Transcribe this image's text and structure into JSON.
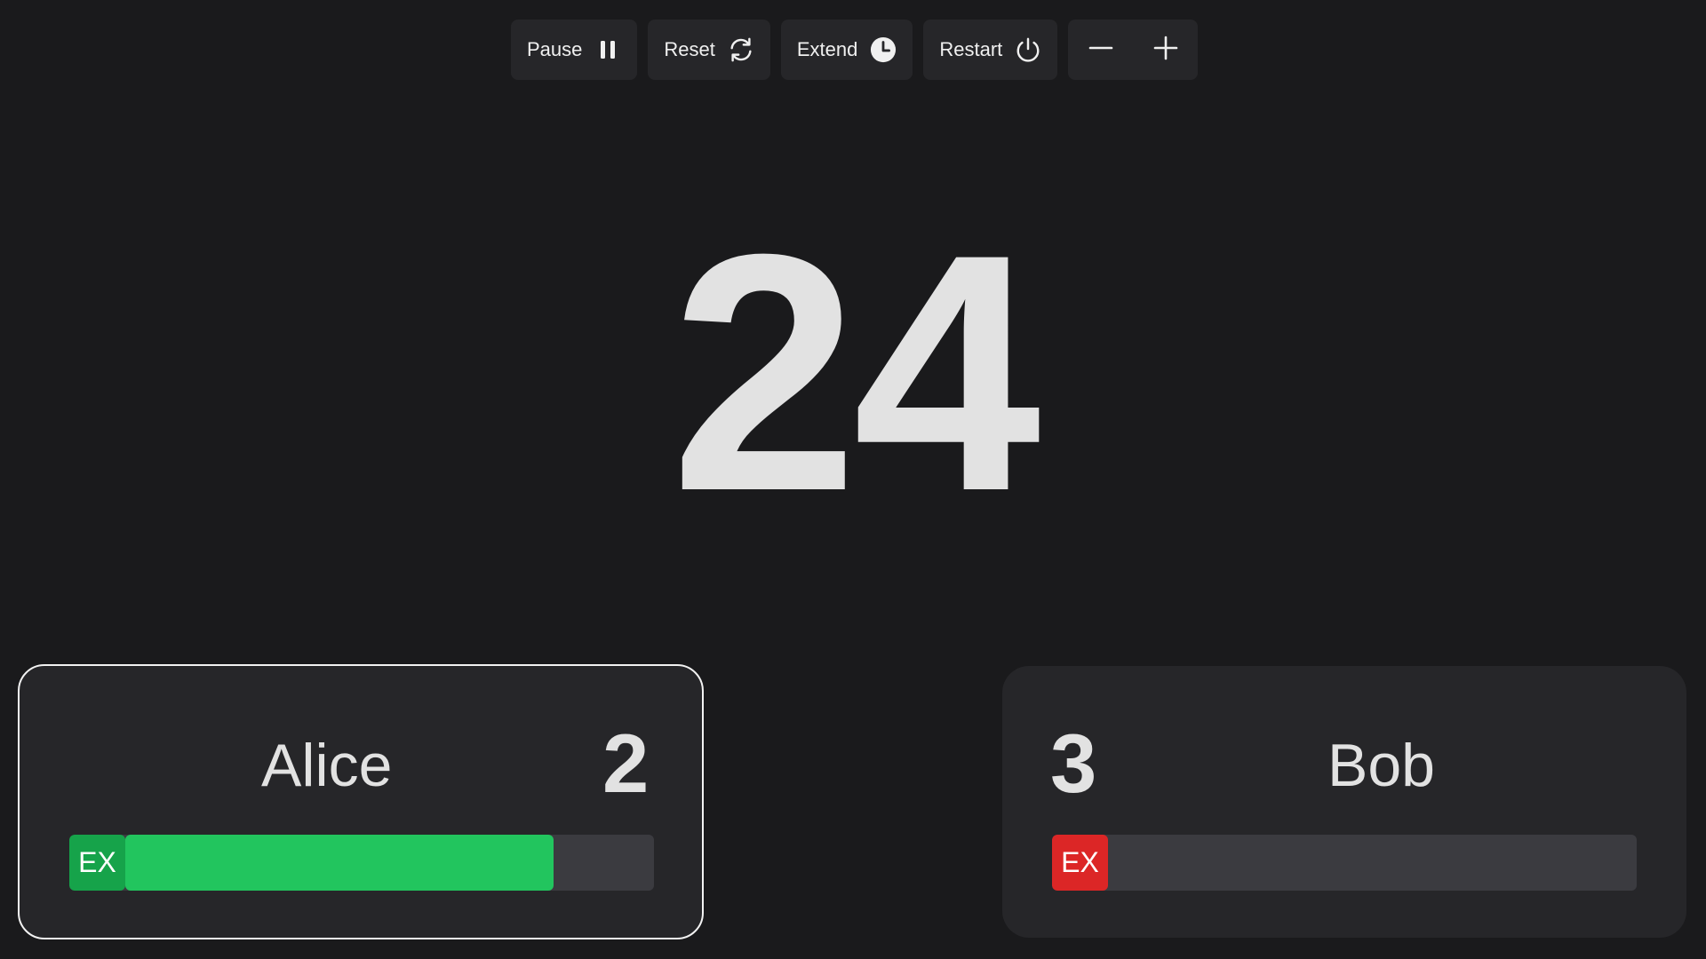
{
  "toolbar": {
    "pause_label": "Pause",
    "pause_icon": "pause-icon",
    "reset_label": "Reset",
    "reset_icon": "refresh-icon",
    "extend_label": "Extend",
    "extend_icon": "clock-icon",
    "restart_label": "Restart",
    "restart_icon": "power-icon",
    "minus_icon": "minus-icon",
    "plus_icon": "plus-icon"
  },
  "timer": {
    "value": "24"
  },
  "players": [
    {
      "name": "Alice",
      "score": "2",
      "ex_label": "EX",
      "ex_color": "#16a34a",
      "bar_fill_color": "#22c55e",
      "bar_fill_fraction": 0.81,
      "active": true
    },
    {
      "name": "Bob",
      "score": "3",
      "ex_label": "EX",
      "ex_color": "#dc2626",
      "bar_fill_color": "#22c55e",
      "bar_fill_fraction": 0.0,
      "active": false
    }
  ],
  "colors": {
    "background": "#1a1a1c",
    "panel": "#262629",
    "bar_track": "#3b3b40",
    "text": "#e2e2e2"
  }
}
